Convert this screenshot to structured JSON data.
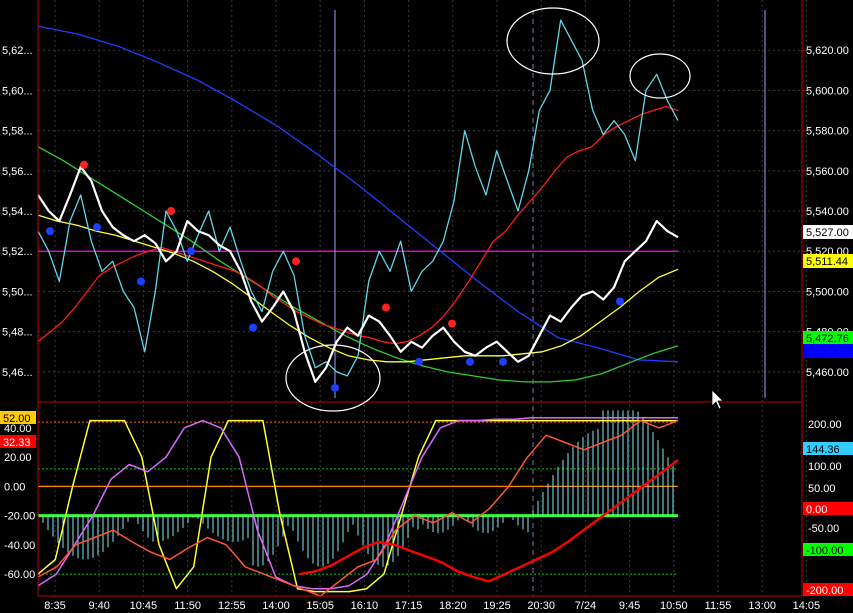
{
  "chart_data": [
    {
      "type": "line",
      "panel": "price",
      "x_ticks": [
        "8:35",
        "9:40",
        "10:45",
        "11:50",
        "12:55",
        "14:00",
        "15:05",
        "16:10",
        "17:15",
        "18:20",
        "19:25",
        "20:30",
        "7/24",
        "9:45",
        "10:50",
        "11:55",
        "13:00",
        "14:05"
      ],
      "left_ticks": [
        "5,62...",
        "5,60...",
        "5,58...",
        "5,56...",
        "5,54...",
        "5,52...",
        "5,50...",
        "5,48...",
        "5,46..."
      ],
      "right_ticks": [
        "5,620.00",
        "5,600.00",
        "5,580.00",
        "5,560.00",
        "5,540.00",
        "5,520.00",
        "5,500.00",
        "5,480.00",
        "5,460.00"
      ],
      "ylim": [
        5447,
        5640
      ],
      "grid": true,
      "badges": [
        {
          "label": "5,527.00",
          "value": 5527,
          "bg": "#ffffff",
          "fg": "#000000"
        },
        {
          "label": "5,511.44",
          "value": 5511.44,
          "bg": "#ffff00",
          "fg": "#000000"
        },
        {
          "label": "5,472.76",
          "value": 5472.76,
          "bg": "#00ff00",
          "fg": "#000000"
        },
        {
          "label": "",
          "value": 5465,
          "bg": "#0000ff",
          "fg": "#ffffff"
        }
      ],
      "horizontal_line": {
        "value": 5520,
        "color": "#ff00ff"
      },
      "vertical_markers": [
        {
          "x": 335,
          "color": "#a0a0ff"
        },
        {
          "x": 765,
          "color": "#a0a0ff"
        }
      ],
      "series": [
        {
          "color": "#ffffff",
          "values": [
            5548,
            5540,
            5535,
            5548,
            5562,
            5555,
            5540,
            5532,
            5528,
            5525,
            5528,
            5524,
            5515,
            5520,
            5535,
            5530,
            5528,
            5523,
            5520,
            5510,
            5495,
            5485,
            5492,
            5500,
            5490,
            5470,
            5455,
            5462,
            5475,
            5482,
            5478,
            5488,
            5485,
            5478,
            5470,
            5475,
            5472,
            5478,
            5482,
            5475,
            5470,
            5468,
            5472,
            5475,
            5470,
            5465,
            5468,
            5478,
            5488,
            5485,
            5492,
            5498,
            5500,
            5496,
            5502,
            5515,
            5520,
            5525,
            5535,
            5530,
            5527
          ]
        },
        {
          "color": "#5fd7e6",
          "values": [
            5530,
            5520,
            5505,
            5535,
            5548,
            5525,
            5510,
            5515,
            5500,
            5492,
            5470,
            5500,
            5540,
            5530,
            5515,
            5528,
            5540,
            5520,
            5532,
            5515,
            5500,
            5490,
            5510,
            5520,
            5508,
            5478,
            5462,
            5465,
            5460,
            5458,
            5468,
            5505,
            5520,
            5510,
            5525,
            5500,
            5510,
            5515,
            5525,
            5545,
            5580,
            5562,
            5548,
            5570,
            5555,
            5540,
            5560,
            5590,
            5600,
            5635,
            5625,
            5615,
            5590,
            5578,
            5585,
            5578,
            5565,
            5600,
            5608,
            5595,
            5585
          ]
        },
        {
          "color": "#ff1a1a",
          "values": [
            5475,
            5480,
            5485,
            5492,
            5500,
            5508,
            5512,
            5515,
            5518,
            5520,
            5522,
            5520,
            5518,
            5516,
            5514,
            5512,
            5510,
            5507,
            5503,
            5498,
            5494,
            5490,
            5487,
            5484,
            5482,
            5480,
            5478,
            5477,
            5475,
            5474,
            5475,
            5478,
            5482,
            5488,
            5496,
            5505,
            5515,
            5525,
            5530,
            5538,
            5545,
            5552,
            5560,
            5567,
            5570,
            5572,
            5578,
            5582,
            5585,
            5588,
            5590,
            5592,
            5590
          ]
        },
        {
          "color": "#ffff33",
          "values": [
            5538,
            5535,
            5533,
            5530,
            5528,
            5525,
            5522,
            5519,
            5515,
            5510,
            5504,
            5497,
            5490,
            5483,
            5477,
            5472,
            5468,
            5466,
            5465,
            5465,
            5466,
            5467,
            5468,
            5468,
            5468,
            5469,
            5470,
            5473,
            5478,
            5485,
            5492,
            5500,
            5507,
            5511
          ]
        },
        {
          "color": "#33cc33",
          "values": [
            5572,
            5565,
            5557,
            5549,
            5541,
            5533,
            5525,
            5516,
            5508,
            5500,
            5492,
            5485,
            5478,
            5472,
            5467,
            5463,
            5460,
            5458,
            5456,
            5455,
            5455,
            5456,
            5459,
            5464,
            5469,
            5473
          ]
        },
        {
          "color": "#1f3fff",
          "values": [
            5632,
            5628,
            5622,
            5614,
            5605,
            5594,
            5582,
            5568,
            5553,
            5537,
            5521,
            5505,
            5490,
            5477,
            5472,
            5466,
            5465
          ]
        }
      ],
      "red_dots": [
        5563,
        5540,
        5515,
        5492,
        5484
      ],
      "blue_dots": [
        5530,
        5532,
        5505,
        5520,
        5482,
        5452,
        5465,
        5465,
        5465,
        5495
      ]
    },
    {
      "type": "line",
      "panel": "oscillator",
      "left_ticks": [
        "40.00",
        "20.00",
        "0.00",
        "-20.00",
        "-40.00",
        "-60.00"
      ],
      "right_ticks": [
        "200.00",
        "100.00",
        "50.00",
        "-50.00",
        "-100.00"
      ],
      "badges": [
        {
          "label": "52.00",
          "bg": "#ffcc00",
          "fg": "#000000",
          "side": "left"
        },
        {
          "label": "32.33",
          "bg": "#ff0000",
          "fg": "#ffffff",
          "side": "left"
        },
        {
          "label": "144.36",
          "bg": "#33ccff",
          "fg": "#000000",
          "side": "right"
        },
        {
          "label": "0.00",
          "bg": "#ff0000",
          "fg": "#ffffff",
          "side": "right"
        },
        {
          "label": "-100.00",
          "bg": "#00ff00",
          "fg": "#000000",
          "side": "right"
        },
        {
          "label": "-200.00",
          "bg": "#ff0000",
          "fg": "#ffffff",
          "side": "right"
        }
      ],
      "ylim": [
        -75,
        55
      ],
      "series": [
        {
          "color": "#ffff33",
          "values": [
            -60,
            -50,
            0,
            45,
            45,
            45,
            20,
            -40,
            -70,
            -55,
            20,
            45,
            45,
            45,
            -20,
            -70,
            -72,
            -72,
            -72,
            -70,
            -60,
            -20,
            20,
            45,
            45,
            45,
            45,
            45,
            45,
            45,
            45,
            45,
            45,
            45,
            45,
            45,
            45,
            45
          ]
        },
        {
          "color": "#dd66ff",
          "values": [
            -68,
            -60,
            -40,
            -20,
            5,
            15,
            10,
            20,
            40,
            45,
            40,
            20,
            -30,
            -62,
            -68,
            -70,
            -70,
            -68,
            -60,
            -40,
            -10,
            20,
            40,
            45,
            45,
            46,
            46,
            47,
            47,
            47,
            47,
            47,
            47,
            47,
            47,
            47
          ]
        },
        {
          "color": "#ff5533",
          "values": [
            -62,
            -55,
            -40,
            -35,
            -30,
            -38,
            -45,
            -50,
            -42,
            -35,
            -40,
            -55,
            -60,
            -65,
            -70,
            -75,
            -65,
            -55,
            -50,
            -30,
            -20,
            -25,
            -18,
            -25,
            -15,
            0,
            20,
            35,
            30,
            25,
            30,
            35,
            45,
            40,
            45
          ]
        },
        {
          "color": "#ff0000",
          "values": [
            -60,
            -58,
            -54,
            -48,
            -42,
            -38,
            -40,
            -44,
            -48,
            -52,
            -58,
            -62,
            -65,
            -60,
            -55,
            -50,
            -45,
            -38,
            -30,
            -22,
            -14,
            -6,
            2,
            10,
            18
          ]
        }
      ]
    }
  ]
}
